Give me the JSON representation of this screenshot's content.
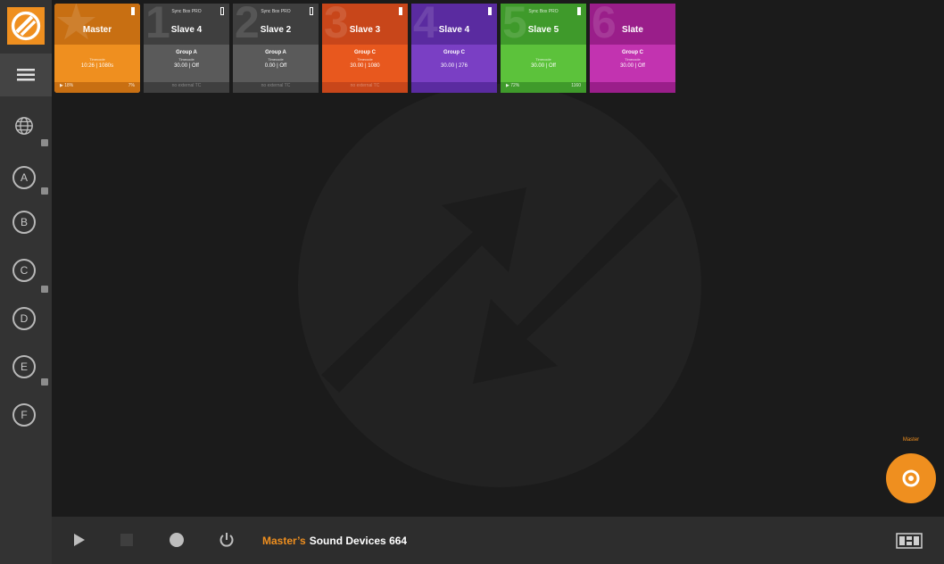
{
  "rail": {
    "groups": [
      {
        "label": "A",
        "badge": true
      },
      {
        "label": "B",
        "badge": false
      },
      {
        "label": "C",
        "badge": true
      },
      {
        "label": "D",
        "badge": false
      },
      {
        "label": "E",
        "badge": true
      },
      {
        "label": "F",
        "badge": false
      }
    ]
  },
  "tiles": [
    {
      "number": "★",
      "model": "",
      "name": "Master",
      "group": "",
      "sub": "Timecode",
      "tc": "10:26 | 1080s",
      "foot_left": "▶ 18%",
      "foot_right": "7%",
      "dark": "#c86f12",
      "light": "#ef8f1f",
      "selected": true
    },
    {
      "number": "1",
      "model": "Sync Box PRO",
      "name": "Slave 4",
      "group": "Group A",
      "sub": "Timecode",
      "tc": "30.00 | Off",
      "foot_left": "",
      "foot_right": "",
      "foot_center": "no external TC",
      "dark": "#3f3f3f",
      "light": "#5a5a5a",
      "selected": false
    },
    {
      "number": "2",
      "model": "Sync Box PRO",
      "name": "Slave 2",
      "group": "Group A",
      "sub": "Timecode",
      "tc": "0.00 | Off",
      "foot_left": "",
      "foot_right": "",
      "foot_center": "no external TC",
      "dark": "#3f3f3f",
      "light": "#5a5a5a",
      "selected": false
    },
    {
      "number": "3",
      "model": "",
      "name": "Slave 3",
      "group": "Group C",
      "sub": "Timecode",
      "tc": "30.00 | 1080",
      "foot_left": "",
      "foot_right": "",
      "foot_center": "no external TC",
      "dark": "#c8461a",
      "light": "#e8581e",
      "selected": false
    },
    {
      "number": "4",
      "model": "",
      "name": "Slave 4",
      "group": "Group C",
      "sub": "",
      "tc": "30.00 | 276",
      "foot_left": "",
      "foot_right": "",
      "foot_center": "",
      "dark": "#5a2ba0",
      "light": "#7a3fc4",
      "selected": false
    },
    {
      "number": "5",
      "model": "Sync Box PRO",
      "name": "Slave 5",
      "group": "",
      "sub": "Timecode",
      "tc": "30.00 | Off",
      "foot_left": "▶ 72%",
      "foot_right": "1160",
      "dark": "#3f9a2b",
      "light": "#5cc23b",
      "selected": false
    },
    {
      "number": "6",
      "model": "",
      "name": "Slate",
      "group": "Group C",
      "sub": "Timecode",
      "tc": "30.00 | Off",
      "foot_left": "",
      "foot_right": "",
      "foot_center": "",
      "dark": "#9a1e8a",
      "light": "#c233b0",
      "selected": false
    }
  ],
  "fab": {
    "label": "Master"
  },
  "statusbar": {
    "master_label": "Master’s",
    "device": "Sound Devices 664"
  },
  "colors": {
    "accent": "#ef8f1f",
    "rail": "#333333",
    "background": "#1b1b1b"
  }
}
